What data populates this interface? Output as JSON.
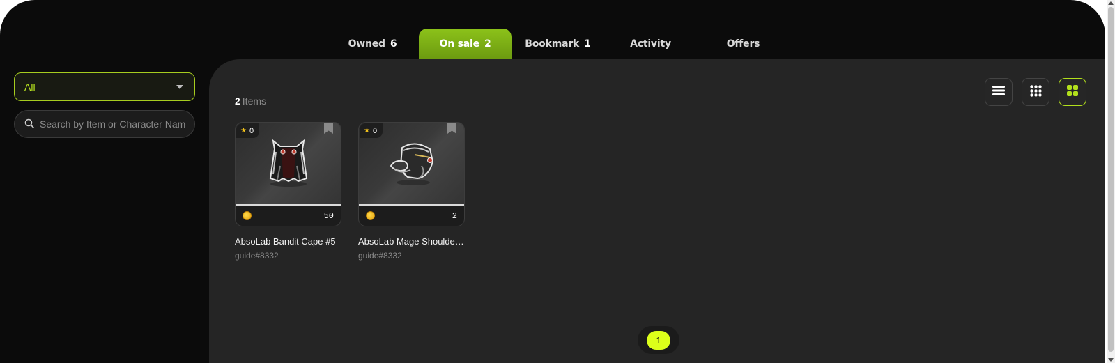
{
  "tabs": [
    {
      "label": "Owned",
      "count": "6"
    },
    {
      "label": "On sale",
      "count": "2"
    },
    {
      "label": "Bookmark",
      "count": "1"
    },
    {
      "label": "Activity",
      "count": ""
    },
    {
      "label": "Offers",
      "count": ""
    }
  ],
  "active_tab": "On sale",
  "filter": {
    "selected": "All"
  },
  "search": {
    "placeholder": "Search by Item or Character Name",
    "value": ""
  },
  "results": {
    "count": "2",
    "label": "Items"
  },
  "view_modes": [
    "list-view",
    "small-grid-view",
    "large-grid-view"
  ],
  "active_view": "large-grid-view",
  "items": [
    {
      "likes": "0",
      "price": "50",
      "name": "AbsoLab Bandit Cape #5",
      "owner": "guide#8332",
      "icon": "cape-icon"
    },
    {
      "likes": "0",
      "price": "2",
      "name": "AbsoLab Mage Shoulder Mount",
      "owner": "guide#8332",
      "icon": "shoulder-icon"
    }
  ],
  "pagination": {
    "current": "1"
  },
  "colors": {
    "accent": "#dcff1a",
    "tab_active": "#7cb114",
    "background": "#0b0b0b",
    "panel": "#252525"
  }
}
